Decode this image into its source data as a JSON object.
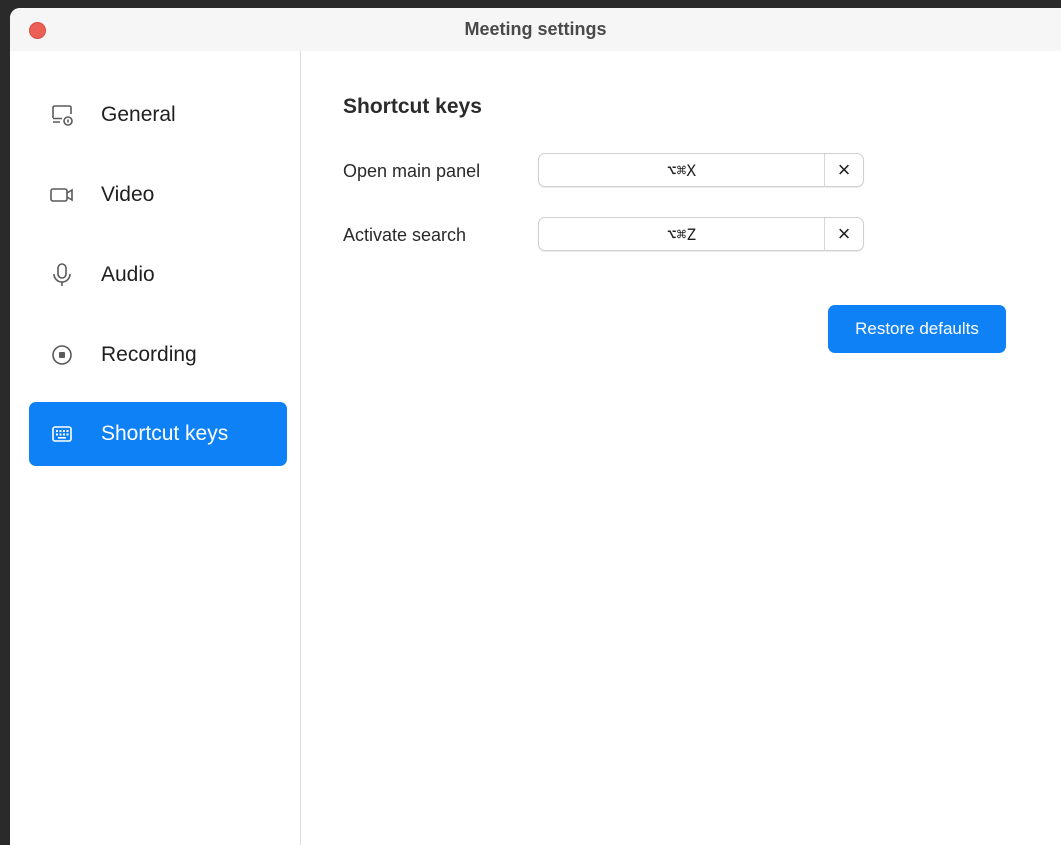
{
  "window": {
    "title": "Meeting settings"
  },
  "sidebar": {
    "items": [
      {
        "label": "General",
        "icon": "monitor-settings-icon",
        "active": false
      },
      {
        "label": "Video",
        "icon": "video-camera-icon",
        "active": false
      },
      {
        "label": "Audio",
        "icon": "microphone-icon",
        "active": false
      },
      {
        "label": "Recording",
        "icon": "record-icon",
        "active": false
      },
      {
        "label": "Shortcut keys",
        "icon": "keyboard-icon",
        "active": true
      }
    ]
  },
  "main": {
    "section_title": "Shortcut keys",
    "shortcuts": [
      {
        "label": "Open main panel",
        "value": "⌥⌘X",
        "clear": "×"
      },
      {
        "label": "Activate search",
        "value": "⌥⌘Z",
        "clear": "×"
      }
    ],
    "restore_label": "Restore defaults"
  },
  "colors": {
    "accent": "#0e81f7",
    "close": "#ec5f56"
  }
}
